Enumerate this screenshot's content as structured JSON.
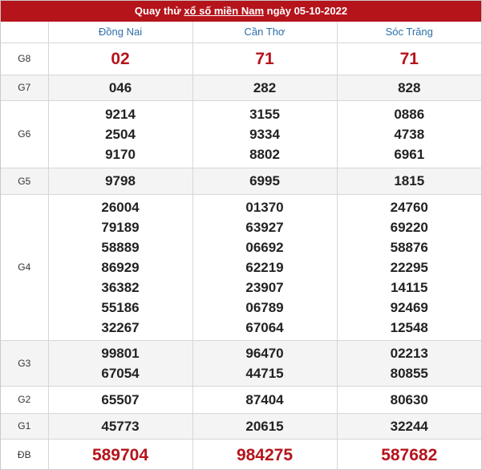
{
  "header": {
    "prefix": "Quay thử ",
    "link_text": "xổ số miền Nam",
    "suffix": " ngày 05-10-2022",
    "bg_color": "#b5141b"
  },
  "provinces": [
    "Đồng Nai",
    "Cần Thơ",
    "Sóc Trăng"
  ],
  "rows": [
    {
      "label": "G8",
      "style": "big",
      "values": [
        [
          "02"
        ],
        [
          "71"
        ],
        [
          "71"
        ]
      ]
    },
    {
      "label": "G7",
      "style": "num",
      "values": [
        [
          "046"
        ],
        [
          "282"
        ],
        [
          "828"
        ]
      ]
    },
    {
      "label": "G6",
      "style": "num",
      "values": [
        [
          "9214",
          "2504",
          "9170"
        ],
        [
          "3155",
          "9334",
          "8802"
        ],
        [
          "0886",
          "4738",
          "6961"
        ]
      ]
    },
    {
      "label": "G5",
      "style": "num",
      "values": [
        [
          "9798"
        ],
        [
          "6995"
        ],
        [
          "1815"
        ]
      ]
    },
    {
      "label": "G4",
      "style": "num",
      "values": [
        [
          "26004",
          "79189",
          "58889",
          "86929",
          "36382",
          "55186",
          "32267"
        ],
        [
          "01370",
          "63927",
          "06692",
          "62219",
          "23907",
          "06789",
          "67064"
        ],
        [
          "24760",
          "69220",
          "58876",
          "22295",
          "14115",
          "92469",
          "12548"
        ]
      ]
    },
    {
      "label": "G3",
      "style": "num",
      "values": [
        [
          "99801",
          "67054"
        ],
        [
          "96470",
          "44715"
        ],
        [
          "02213",
          "80855"
        ]
      ]
    },
    {
      "label": "G2",
      "style": "num",
      "values": [
        [
          "65507"
        ],
        [
          "87404"
        ],
        [
          "80630"
        ]
      ]
    },
    {
      "label": "G1",
      "style": "num",
      "values": [
        [
          "45773"
        ],
        [
          "20615"
        ],
        [
          "32244"
        ]
      ]
    },
    {
      "label": "ĐB",
      "style": "big",
      "values": [
        [
          "589704"
        ],
        [
          "984275"
        ],
        [
          "587682"
        ]
      ]
    }
  ]
}
